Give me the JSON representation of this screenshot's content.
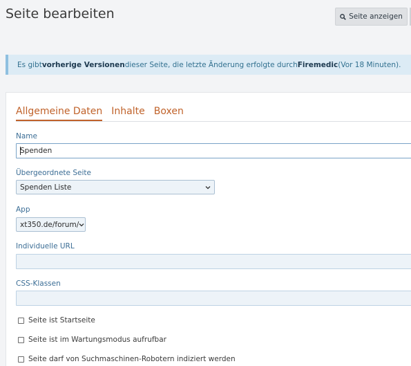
{
  "header": {
    "title": "Seite bearbeiten",
    "view_button_label": "Seite anzeigen",
    "view_button_icon": "search-icon"
  },
  "notice": {
    "prefix": "Es gibt ",
    "link_versions": "vorherige Versionen",
    "middle": " dieser Seite, die letzte Änderung erfolgte durch ",
    "user": "Firemedic",
    "suffix": " (Vor 18 Minuten)."
  },
  "tabs": [
    {
      "label": "Allgemeine Daten",
      "active": true
    },
    {
      "label": "Inhalte",
      "active": false
    },
    {
      "label": "Boxen",
      "active": false
    }
  ],
  "form": {
    "name": {
      "label": "Name",
      "value": "Spenden"
    },
    "parent": {
      "label": "Übergeordnete Seite",
      "value": "Spenden Liste"
    },
    "app": {
      "label": "App",
      "value": "xt350.de/forum/"
    },
    "custom_url": {
      "label": "Individuelle URL",
      "value": ""
    },
    "css_classes": {
      "label": "CSS-Klassen",
      "value": ""
    },
    "checkboxes": [
      {
        "label": "Seite ist Startseite",
        "checked": false
      },
      {
        "label": "Seite ist im Wartungsmodus aufrufbar",
        "checked": false
      },
      {
        "label": "Seite darf von Suchmaschinen-Robotern indiziert werden",
        "checked": false
      }
    ]
  },
  "colors": {
    "accent": "#c0622a",
    "label_blue": "#3b6d95",
    "notice_bg": "#dcebf5",
    "notice_text": "#31708f"
  }
}
